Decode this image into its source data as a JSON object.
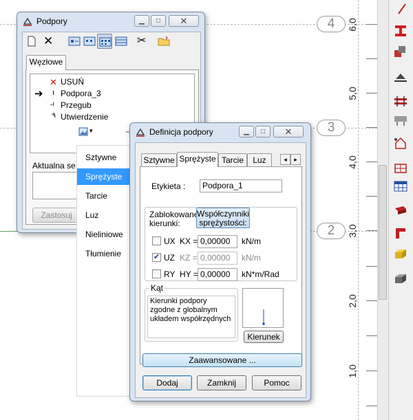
{
  "canvas": {
    "axis_bubbles": [
      "4",
      "3",
      "2"
    ],
    "ruler_labels": [
      "6,0",
      "5,0",
      "4,0",
      "3,0",
      "2,0",
      "1,0"
    ]
  },
  "podpory": {
    "title": "Podpory",
    "tab_label": "Węzłowe",
    "tree_items": [
      "USUŃ",
      "Podpora_3",
      "Przegub",
      "Utwierdzenie"
    ],
    "aktualna_label": "Aktualna se",
    "zastosuj_label": "Zastosuj"
  },
  "context_menu": {
    "items": [
      "Sztywne",
      "Sprężyste",
      "Tarcie",
      "Luz",
      "Nieliniowe",
      "Tłumienie"
    ],
    "selected_index": 1
  },
  "definicja": {
    "title": "Definicja podpory",
    "tabs": [
      "Sztywne",
      "Sprężyste",
      "Tarcie",
      "Luz"
    ],
    "active_tab": "Sprężyste",
    "etykieta_label": "Etykieta :",
    "etykieta_value": "Podpora_1",
    "zablokowane_label": "Zablokowane\nkierunki:",
    "wspolczynniki_label": "Współczynniki\nsprężystości:",
    "rows": [
      {
        "dir": "UX",
        "coef": "KX =",
        "value": "0,00000",
        "unit": "kN/m",
        "checked": false,
        "disabled": false
      },
      {
        "dir": "UZ",
        "coef": "KZ =",
        "value": "0,00000",
        "unit": "kN/m",
        "checked": true,
        "disabled": true
      },
      {
        "dir": "RY",
        "coef": "HY =",
        "value": "0,00000",
        "unit": "kN*m/Rad",
        "checked": false,
        "disabled": false
      }
    ],
    "kat_label": "Kąt",
    "kat_text": "Kierunki podpory zgodne z globalnym układem współrzędnych",
    "kierunek_label": "Kierunek",
    "zaawansowane_label": "Zaawansowane ...",
    "dodaj_label": "Dodaj",
    "zamknij_label": "Zamknij",
    "pomoc_label": "Pomoc"
  }
}
